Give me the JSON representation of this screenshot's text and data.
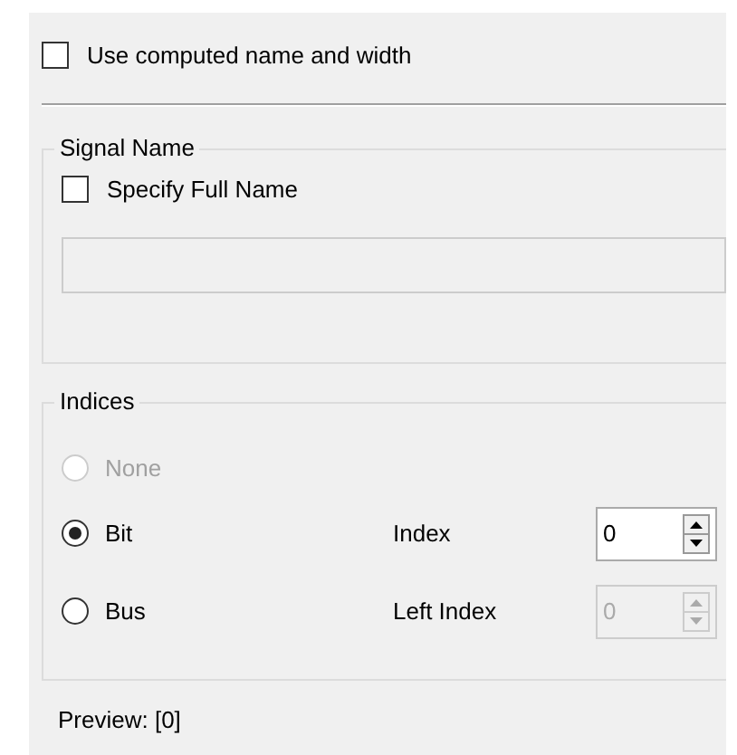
{
  "use_computed": {
    "label": "Use computed name and width",
    "checked": false
  },
  "signal_name": {
    "title": "Signal Name",
    "specify": {
      "label": "Specify Full Name",
      "checked": false
    },
    "name_field": {
      "disabled": true
    }
  },
  "indices": {
    "title": "Indices",
    "options": [
      {
        "label": "None",
        "selected": false,
        "disabled": true
      },
      {
        "label": "Bit",
        "selected": true,
        "disabled": false,
        "field_label": "Index",
        "value": "0",
        "field_disabled": false
      },
      {
        "label": "Bus",
        "selected": false,
        "disabled": false,
        "field_label": "Left Index",
        "value": "0",
        "field_disabled": true
      }
    ]
  },
  "preview": "Preview: [0]"
}
